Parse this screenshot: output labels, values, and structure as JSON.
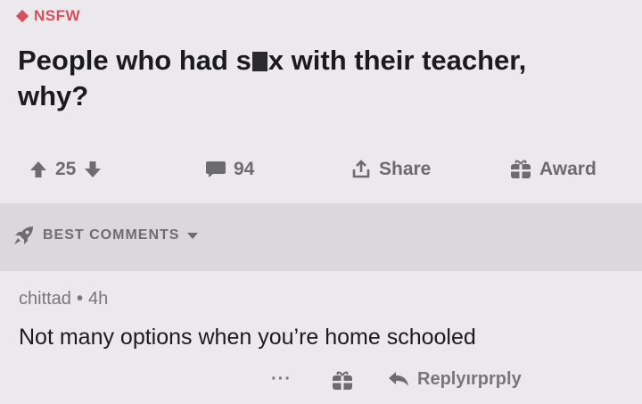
{
  "post": {
    "nsfw_label": "NSFW",
    "title_before": "People who had s",
    "title_after": "x with their teacher,",
    "title_line2": "why?",
    "upvotes": "25",
    "comments_count": "94",
    "share_label": "Share",
    "award_label": "Award"
  },
  "sort": {
    "label": "BEST COMMENTS"
  },
  "comment": {
    "author": "chittad",
    "separator": "•",
    "age": "4h",
    "text": "Not many options when you’re home schooled",
    "more_label": "···",
    "reply_label": "Replyırprply"
  },
  "colors": {
    "nsfw": "#d4505f",
    "background": "#ebe9ec",
    "sort_bar": "#dad8dc",
    "muted": "#6c6b6f"
  },
  "icons": [
    "nsfw-diamond-icon",
    "upvote-arrow-icon",
    "downvote-arrow-icon",
    "comment-bubble-icon",
    "share-icon",
    "award-gift-icon",
    "rocket-icon",
    "caret-down-icon",
    "reply-arrow-icon"
  ]
}
